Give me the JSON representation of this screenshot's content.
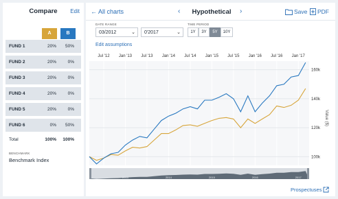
{
  "compare_panel": {
    "title": "Compare",
    "edit_label": "Edit",
    "column_a": "A",
    "column_b": "B",
    "funds": [
      {
        "name": "FUND 1",
        "a": "20%",
        "b": "50%"
      },
      {
        "name": "FUND 2",
        "a": "20%",
        "b": "0%"
      },
      {
        "name": "FUND 3",
        "a": "20%",
        "b": "0%"
      },
      {
        "name": "FUND 4",
        "a": "20%",
        "b": "0%"
      },
      {
        "name": "FUND 5",
        "a": "20%",
        "b": "0%"
      },
      {
        "name": "FUND 6",
        "a": "0%",
        "b": "50%"
      }
    ],
    "total": {
      "name": "Total",
      "a": "100%",
      "b": "100%"
    },
    "benchmark_label": "BENCHMARK",
    "benchmark_value": "Benchmark Index"
  },
  "header": {
    "back_label": "All charts",
    "title": "Hypothetical",
    "save_label": "Save",
    "pdf_label": "PDF"
  },
  "controls": {
    "date_range_label": "DATE RANGE",
    "start_date": "03/2012",
    "end_date": "0'2017",
    "time_period_label": "TIME PERIOD",
    "periods": [
      "1Y",
      "3Y",
      "5Y",
      "10Y"
    ],
    "active_period": "5Y",
    "edit_assumptions_label": "Edit assumptions"
  },
  "colors": {
    "series_a": "#d7a53a",
    "series_b": "#2878c0",
    "accent": "#2c6fb6"
  },
  "chart_data": {
    "type": "line",
    "x_tick_labels": [
      "Jul '12",
      "Jan '13",
      "Jul '13",
      "Jan '14",
      "Jul '14",
      "Jan '15",
      "Jul '15",
      "Jan '16",
      "Jul '16",
      "Jan '17"
    ],
    "y_tick_labels": [
      "100k",
      "120k",
      "140k",
      "160k"
    ],
    "ylabel": "Value ($)",
    "ylim": [
      94,
      166
    ],
    "grid": true,
    "navigator_labels": [
      "2013",
      "2014",
      "2015",
      "2016",
      "2017"
    ],
    "series": [
      {
        "color": "#d7a53a",
        "x": [
          "2012-03",
          "2012-05",
          "2012-07",
          "2012-09",
          "2012-11",
          "2013-01",
          "2013-03",
          "2013-05",
          "2013-07",
          "2013-09",
          "2013-11",
          "2014-01",
          "2014-03",
          "2014-05",
          "2014-07",
          "2014-09",
          "2014-11",
          "2015-01",
          "2015-03",
          "2015-05",
          "2015-07",
          "2015-09",
          "2015-11",
          "2016-01",
          "2016-03",
          "2016-05",
          "2016-07",
          "2016-09",
          "2016-11",
          "2017-01",
          "2017-03"
        ],
        "values": [
          100,
          97.5,
          99,
          101.5,
          101,
          104,
          106.5,
          106,
          107,
          111.5,
          116,
          116,
          118.5,
          121.5,
          122,
          121,
          123,
          125,
          126.5,
          127,
          126,
          120,
          126,
          123,
          126,
          129,
          135,
          134,
          135.5,
          139,
          147
        ]
      },
      {
        "color": "#2878c0",
        "x": [
          "2012-03",
          "2012-05",
          "2012-07",
          "2012-09",
          "2012-11",
          "2013-01",
          "2013-03",
          "2013-05",
          "2013-07",
          "2013-09",
          "2013-11",
          "2014-01",
          "2014-03",
          "2014-05",
          "2014-07",
          "2014-09",
          "2014-11",
          "2015-01",
          "2015-03",
          "2015-05",
          "2015-07",
          "2015-09",
          "2015-11",
          "2016-01",
          "2016-03",
          "2016-05",
          "2016-07",
          "2016-09",
          "2016-11",
          "2017-01",
          "2017-03"
        ],
        "values": [
          100,
          95,
          99,
          102,
          103,
          108,
          111.5,
          114,
          113,
          119,
          125,
          128,
          130,
          133,
          134.5,
          133,
          139,
          139,
          141,
          143.5,
          140,
          131,
          142,
          131,
          137,
          142,
          149,
          150,
          155,
          156,
          165
        ]
      }
    ]
  },
  "footer": {
    "prospectuses_label": "Prospectuses"
  }
}
